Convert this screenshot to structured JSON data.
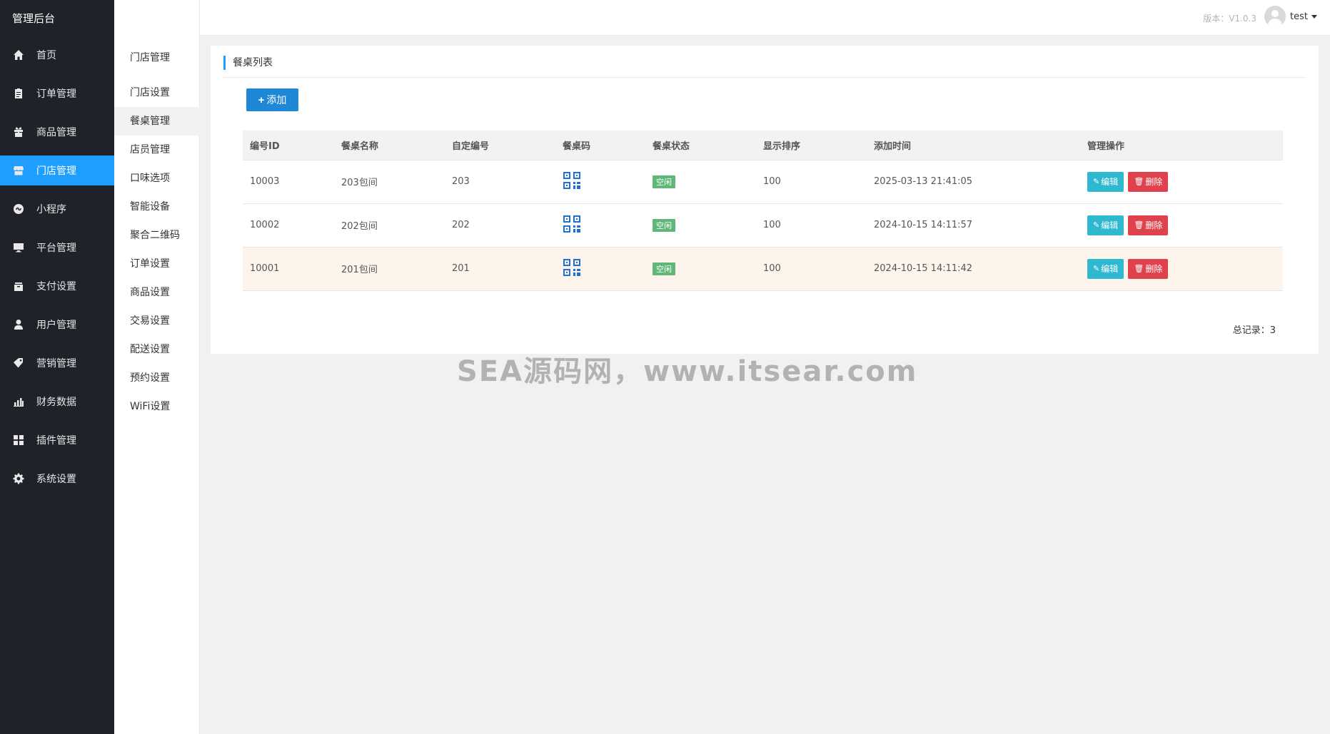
{
  "app": {
    "title": "管理后台"
  },
  "sidebar": {
    "items": [
      {
        "label": "首页",
        "icon": "home-icon"
      },
      {
        "label": "订单管理",
        "icon": "clipboard-icon"
      },
      {
        "label": "商品管理",
        "icon": "gift-icon"
      },
      {
        "label": "门店管理",
        "icon": "store-icon",
        "active": true
      },
      {
        "label": "小程序",
        "icon": "miniprogram-icon"
      },
      {
        "label": "平台管理",
        "icon": "monitor-icon"
      },
      {
        "label": "支付设置",
        "icon": "payment-icon"
      },
      {
        "label": "用户管理",
        "icon": "user-icon"
      },
      {
        "label": "营销管理",
        "icon": "tag-icon"
      },
      {
        "label": "财务数据",
        "icon": "bar-chart-icon"
      },
      {
        "label": "插件管理",
        "icon": "plugin-icon"
      },
      {
        "label": "系统设置",
        "icon": "gear-icon"
      }
    ]
  },
  "subnav": {
    "header": "门店管理",
    "items": [
      {
        "label": "门店设置"
      },
      {
        "label": "餐桌管理",
        "active": true
      },
      {
        "label": "店员管理"
      },
      {
        "label": "口味选项"
      },
      {
        "label": "智能设备"
      },
      {
        "label": "聚合二维码"
      },
      {
        "label": "订单设置"
      },
      {
        "label": "商品设置"
      },
      {
        "label": "交易设置"
      },
      {
        "label": "配送设置"
      },
      {
        "label": "预约设置"
      },
      {
        "label": "WiFi设置"
      }
    ]
  },
  "header": {
    "version": "版本：V1.0.3",
    "username": "test"
  },
  "card": {
    "title": "餐桌列表",
    "add_label": "添加",
    "columns": [
      "编号ID",
      "餐桌名称",
      "自定编号",
      "餐桌码",
      "餐桌状态",
      "显示排序",
      "添加时间",
      "管理操作"
    ],
    "rows": [
      {
        "id": "10003",
        "name": "203包间",
        "code": "203",
        "status": "空闲",
        "sort": "100",
        "time": "2025-03-13 21:41:05",
        "edit": "编辑",
        "delete": "删除"
      },
      {
        "id": "10002",
        "name": "202包间",
        "code": "202",
        "status": "空闲",
        "sort": "100",
        "time": "2024-10-15 14:11:57",
        "edit": "编辑",
        "delete": "删除"
      },
      {
        "id": "10001",
        "name": "201包间",
        "code": "201",
        "status": "空闲",
        "sort": "100",
        "time": "2024-10-15 14:11:42",
        "edit": "编辑",
        "delete": "删除"
      }
    ],
    "total": "总记录：3"
  },
  "watermark": "SEA源码网，www.itsear.com",
  "colors": {
    "accent": "#1e9fff",
    "sidebar_bg": "#20222a",
    "status_green": "#5fb878",
    "edit": "#2fb9d1",
    "delete": "#e0424d"
  }
}
